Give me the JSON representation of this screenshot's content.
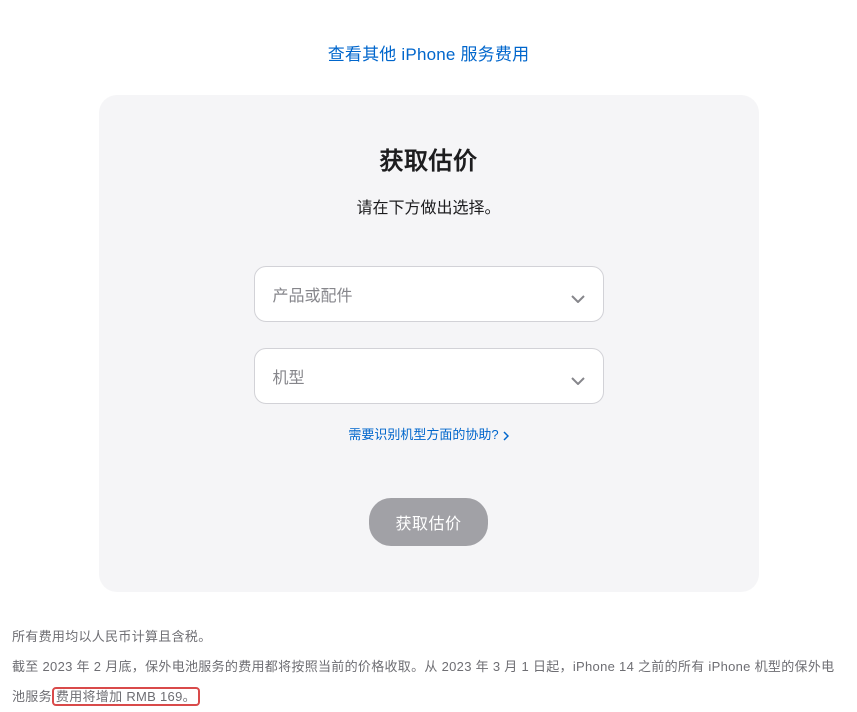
{
  "topLink": {
    "label": "查看其他 iPhone 服务费用"
  },
  "card": {
    "title": "获取估价",
    "subtitle": "请在下方做出选择。",
    "select1": {
      "placeholder": "产品或配件"
    },
    "select2": {
      "placeholder": "机型"
    },
    "helpLink": {
      "label": "需要识别机型方面的协助?"
    },
    "button": {
      "label": "获取估价"
    }
  },
  "footer": {
    "line1": "所有费用均以人民币计算且含税。",
    "line2_part1": "截至 2023 年 2 月底，保外电池服务的费用都将按照当前的价格收取。从 2023 年 3 月 1 日起，iPhone 14 之前的所有 iPhone 机型的保外电池服务",
    "line2_highlight": "费用将增加 RMB 169。"
  }
}
